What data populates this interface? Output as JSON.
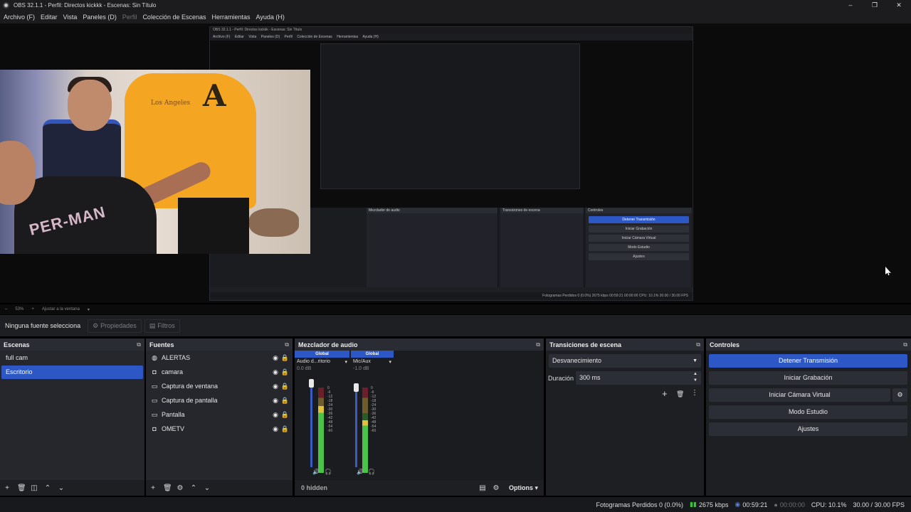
{
  "window": {
    "title": "OBS 32.1.1 - Perfil: Directos kickkk - Escenas: Sin Título",
    "minimize": "–",
    "maximize": "❐",
    "close": "✕"
  },
  "menu": [
    {
      "label": "Archivo (F)",
      "disabled": false
    },
    {
      "label": "Editar",
      "disabled": false
    },
    {
      "label": "Vista",
      "disabled": false
    },
    {
      "label": "Paneles (D)",
      "disabled": false
    },
    {
      "label": "Perfil",
      "disabled": true
    },
    {
      "label": "Colección de Escenas",
      "disabled": false
    },
    {
      "label": "Herramientas",
      "disabled": false
    },
    {
      "label": "Ayuda (H)",
      "disabled": false
    }
  ],
  "nested_preview": {
    "title": "OBS 32.1.1 - Perfil: Directos kickkk - Escenas: Sin Título",
    "menu": [
      "Archivo (F)",
      "Editar",
      "Vista",
      "Paneles (D)",
      "Perfil",
      "Colección de Escenas",
      "Herramientas",
      "Ayuda (H)"
    ],
    "docks": [
      "Mezclador de audio",
      "Transiciones de escena",
      "Controles"
    ],
    "buttons": [
      "Detener Transmisión",
      "Iniciar Grabación",
      "Iniciar Cámara Virtual",
      "Modo Estudio",
      "Ajustes"
    ],
    "status": "Fotogramas Perdidos 0 (0.0%)   2675 kbps   00:59:21   00:00:00   CPU: 10.1%   30.00 / 30.00 FPS"
  },
  "webcam": {
    "shirt_text": "PER-MAN",
    "mid_text": "Los Angeles",
    "logo": "A"
  },
  "zoombar": {
    "minus": "–",
    "zoom": "53%",
    "plus": "+",
    "fit": "Ajustar a la ventana",
    "arrow": "▾"
  },
  "source_toolbar": {
    "no_source": "Ninguna fuente selecciona",
    "properties": "Propiedades",
    "filters": "Filtros",
    "properties_icon": "gear-icon",
    "filters_icon": "filter-icon"
  },
  "scenes": {
    "title": "Escenas",
    "items": [
      "full cam",
      "Escritorio"
    ],
    "selected_index": 1
  },
  "sources": {
    "title": "Fuentes",
    "items": [
      {
        "label": "ALERTAS",
        "icon": "browser-icon"
      },
      {
        "label": "camara",
        "icon": "camera-icon"
      },
      {
        "label": "Captura de ventana",
        "icon": "window-icon"
      },
      {
        "label": "Captura de pantalla",
        "icon": "monitor-icon"
      },
      {
        "label": "Pantalla",
        "icon": "monitor-icon"
      },
      {
        "label": "OMETV",
        "icon": "camera-icon"
      }
    ]
  },
  "mixer": {
    "title": "Mezclador de audio",
    "channels": [
      {
        "tag": "Global",
        "name": "Audio d...ritorio",
        "db": "0.0 dB",
        "level": 0.78
      },
      {
        "tag": "Global",
        "name": "Mic/Aux",
        "db": "-1.0 dB",
        "level": 0.62
      }
    ],
    "scale": [
      "0",
      "-6",
      "-12",
      "-18",
      "-24",
      "-30",
      "-36",
      "-42",
      "-48",
      "-54",
      "-60"
    ],
    "hidden": "0 hidden",
    "options": "Options"
  },
  "transitions": {
    "title": "Transiciones de escena",
    "selected": "Desvanecimiento",
    "duration_label": "Duración",
    "duration_value": "300 ms"
  },
  "controls": {
    "title": "Controles",
    "buttons": [
      "Detener Transmisión",
      "Iniciar Grabación",
      "Iniciar Cámara Virtual",
      "Modo Estudio",
      "Ajustes"
    ]
  },
  "status": {
    "dropped": "Fotogramas Perdidos 0 (0.0%)",
    "bitrate": "2675 kbps",
    "stream_time": "00:59:21",
    "rec_time": "00:00:00",
    "cpu": "CPU: 10.1%",
    "fps": "30.00 / 30.00 FPS"
  },
  "colors": {
    "accent": "#2e57c6",
    "panel": "#26272d",
    "header": "#2a2c33",
    "background": "#1e1f23"
  }
}
